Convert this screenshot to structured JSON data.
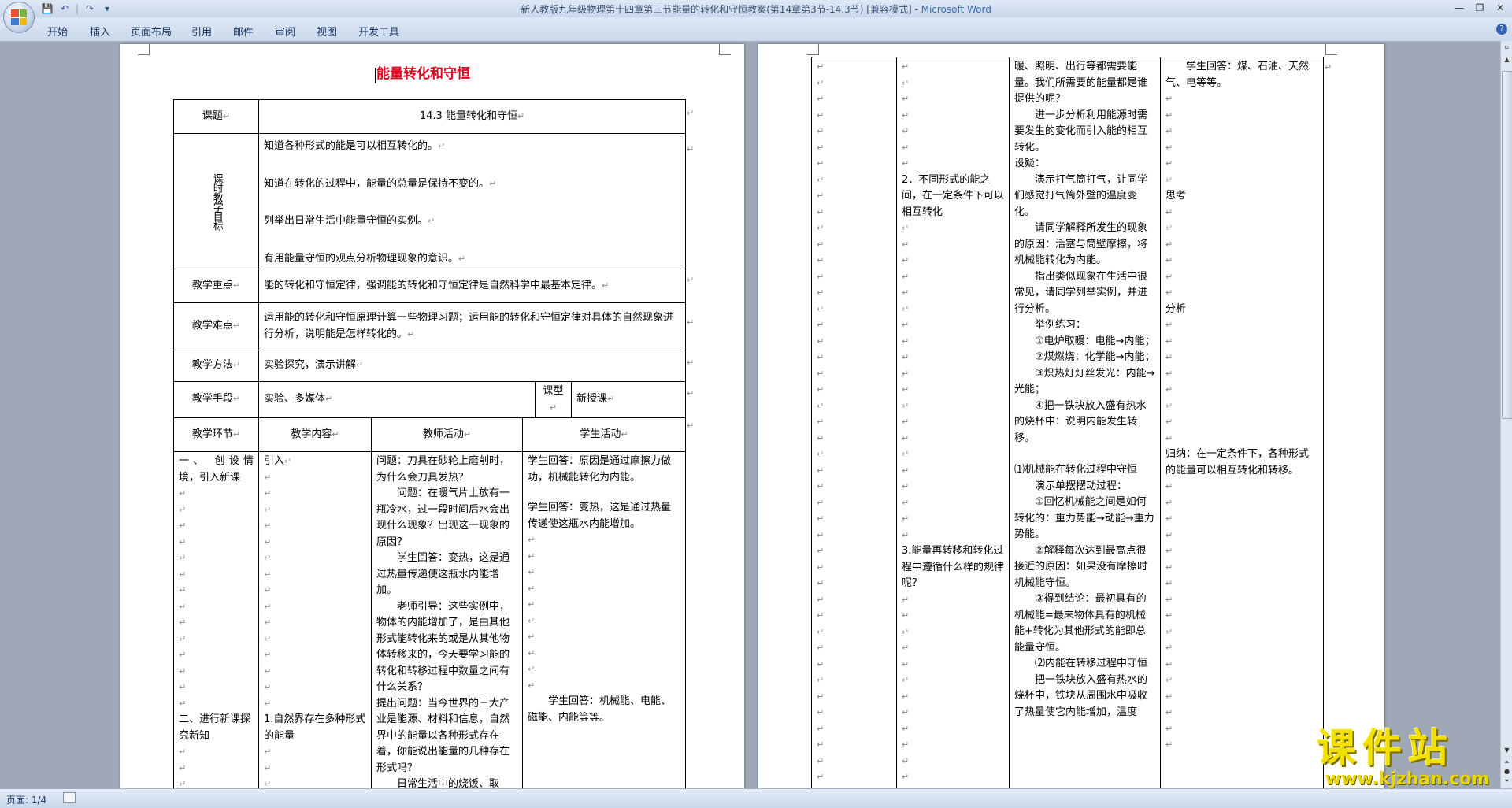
{
  "window": {
    "title": "新人教版九年级物理第十四章第三节能量的转化和守恒教案(第14章第3节-14.3节) [兼容模式]",
    "app_name": "Microsoft Word",
    "title_sep": " - "
  },
  "qat": {
    "save_icon": "save-icon",
    "undo_icon": "undo-icon",
    "redo_icon": "redo-icon"
  },
  "ribbon": {
    "tabs": [
      "开始",
      "插入",
      "页面布局",
      "引用",
      "邮件",
      "审阅",
      "视图",
      "开发工具"
    ],
    "help": "?"
  },
  "status": {
    "page": "页面: 1/4"
  },
  "watermark": {
    "name": "课件站",
    "url": "www.kjzhan.com"
  },
  "page1": {
    "title": "能量转化和守恒",
    "rows": {
      "topic_label": "课题",
      "topic_value": "14.3 能量转化和守恒",
      "goals_label": "课时教学目标",
      "goals": [
        "知道各种形式的能是可以相互转化的。",
        "知道在转化的过程中，能量的总量是保持不变的。",
        "列举出日常生活中能量守恒的实例。",
        "有用能量守恒的观点分析物理现象的意识。"
      ],
      "key_label": "教学重点",
      "key_value": "能的转化和守恒定律，强调能的转化和守恒定律是自然科学中最基本定律。",
      "diff_label": "教学难点",
      "diff_value": "运用能的转化和守恒原理计算一些物理习题；运用能的转化和守恒定律对具体的自然现象进行分析，说明能是怎样转化的。",
      "method_label": "教学方法",
      "method_value": "实验探究，演示讲解",
      "means_label": "教学手段",
      "means_value": "实验、多媒体",
      "type_label": "课型",
      "type_value": "新授课",
      "h_stage": "教学环节",
      "h_content": "教学内容",
      "h_teacher": "教师活动",
      "h_student": "学生活动"
    },
    "stage1": "一、 创设情境，引入新课",
    "stage2": "二、进行新课探究新知",
    "content1": "引入",
    "content2": "1.自然界存在多种形式的能量",
    "teacher": [
      {
        "t": "问题：刀具在砂轮上磨削时，为什么会刀具发热？",
        "indent": false
      },
      {
        "t": "问题：在暖气片上放有一瓶冷水，过一段时间后水会出现什么现象？出现这一现象的原因？",
        "indent": true
      },
      {
        "t": "学生回答：变热，这是通过热量传递使这瓶水内能增加。",
        "indent": true
      },
      {
        "t": "老师引导：这些实例中，物体的内能增加了，是由其他形式能转化来的或是从其他物体转移来的，今天要学习能的转化和转移过程中数量之间有什么关系？",
        "indent": true
      },
      {
        "t": "提出问题：当今世界的三大产业是能源、材料和信息，自然界中的能量以各种形式存在着，你能说出能量的几种存在形式吗？",
        "indent": false
      },
      {
        "t": "日常生活中的烧饭、取",
        "indent": true
      }
    ],
    "student1": "学生回答：原因是通过摩擦力做功，机械能转化为内能。",
    "student2": "学生回答：变热，这是通过热量传递使这瓶水内能增加。",
    "student3": "学生回答：机械能、电能、磁能、内能等等。"
  },
  "page2": {
    "content_a": "2．不同形式的能之间，在一定条件下可以相互转化",
    "content_b": "3.能量再转移和转化过程中遵循什么样的规律呢？",
    "teacher": [
      {
        "t": "暖、照明、出行等都需要能量。我们所需要的能量都是谁提供的呢？",
        "indent": false
      },
      {
        "t": "进一步分析利用能源时需要发生的变化而引入能的相互转化。",
        "indent": true
      },
      {
        "t": "设疑：",
        "indent": false
      },
      {
        "t": "演示打气筒打气，让同学们感觉打气筒外壁的温度变化。",
        "indent": true
      },
      {
        "t": "请同学解释所发生的现象的原因：活塞与筒壁摩擦，将机械能转化为内能。",
        "indent": true
      },
      {
        "t": "指出类似现象在生活中很常见，请同学列举实例，并进行分析。",
        "indent": true
      },
      {
        "t": "举例练习：",
        "indent": true
      },
      {
        "t": "①电炉取暖：电能→内能；",
        "indent": true
      },
      {
        "t": "②煤燃烧：化学能→内能；",
        "indent": true
      },
      {
        "t": "③炽热灯灯丝发光：内能→光能；",
        "indent": true
      },
      {
        "t": "④把一铁块放入盛有热水的烧杯中：说明内能发生转移。",
        "indent": true
      },
      {
        "t": "",
        "indent": false
      },
      {
        "t": "⑴机械能在转化过程中守恒",
        "indent": false
      },
      {
        "t": "演示单摆摆动过程：",
        "indent": true
      },
      {
        "t": "①回忆机械能之间是如何转化的：重力势能→动能→重力势能。",
        "indent": true
      },
      {
        "t": "②解释每次达到最高点很接近的原因：如果没有摩擦时机械能守恒。",
        "indent": true
      },
      {
        "t": "③得到结论：最初具有的机械能=最末物体具有的机械能+转化为其他形式的能即总能量守恒。",
        "indent": true
      },
      {
        "t": "⑵内能在转移过程中守恒",
        "indent": true
      },
      {
        "t": "把一铁块放入盛有热水的烧杯中，铁块从周围水中吸收了热量使它内能增加，温度",
        "indent": true
      }
    ],
    "student_a": "学生回答：煤、石油、天然气、电等等。",
    "student_b": "思考",
    "student_c": "分析",
    "student_d": "归纳：在一定条件下，各种形式的能量可以相互转化和转移。"
  }
}
